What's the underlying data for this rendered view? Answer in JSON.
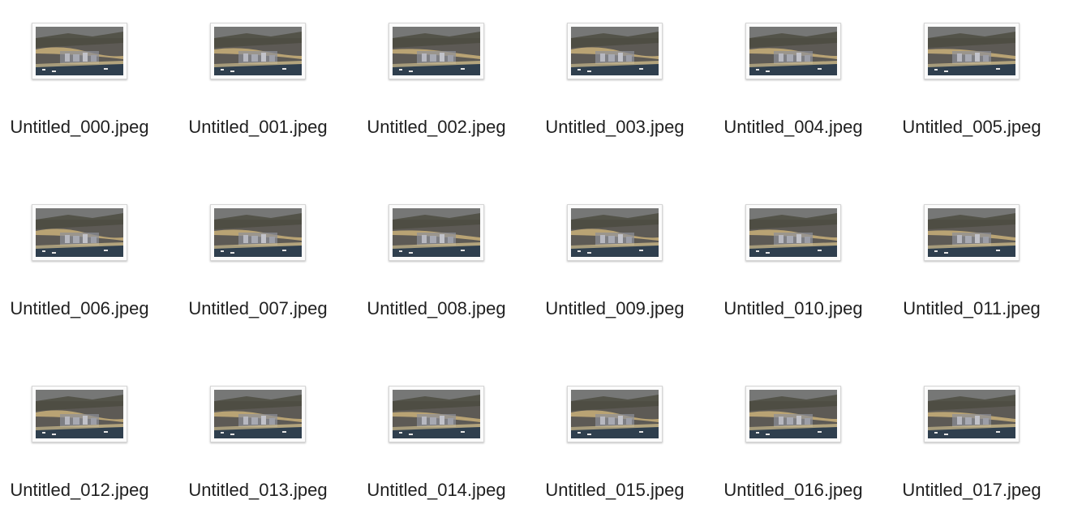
{
  "files": [
    {
      "name": "Untitled_000.jpeg"
    },
    {
      "name": "Untitled_001.jpeg"
    },
    {
      "name": "Untitled_002.jpeg"
    },
    {
      "name": "Untitled_003.jpeg"
    },
    {
      "name": "Untitled_004.jpeg"
    },
    {
      "name": "Untitled_005.jpeg"
    },
    {
      "name": "Untitled_006.jpeg"
    },
    {
      "name": "Untitled_007.jpeg"
    },
    {
      "name": "Untitled_008.jpeg"
    },
    {
      "name": "Untitled_009.jpeg"
    },
    {
      "name": "Untitled_010.jpeg"
    },
    {
      "name": "Untitled_011.jpeg"
    },
    {
      "name": "Untitled_012.jpeg"
    },
    {
      "name": "Untitled_013.jpeg"
    },
    {
      "name": "Untitled_014.jpeg"
    },
    {
      "name": "Untitled_015.jpeg"
    },
    {
      "name": "Untitled_016.jpeg"
    },
    {
      "name": "Untitled_017.jpeg"
    }
  ],
  "colors": {
    "label_text": "#1f1f1f",
    "thumb_border": "#d6d6d6",
    "thumb_sky": "#8a8f92",
    "thumb_city": "#5d5a55",
    "thumb_water": "#2f3f4e",
    "thumb_road": "#c9b07a"
  }
}
